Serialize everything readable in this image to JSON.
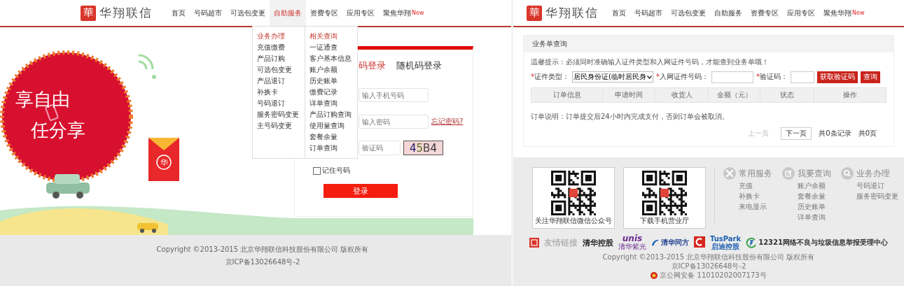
{
  "left_page": {
    "header": {
      "logo_mark": "華",
      "logo_text": "华翔联信",
      "nav": [
        {
          "label": "首页",
          "selected": false
        },
        {
          "label": "号码超市",
          "selected": false
        },
        {
          "label": "可选包变更",
          "selected": false
        },
        {
          "label": "自助服务",
          "selected": true
        },
        {
          "label": "资费专区",
          "selected": false
        },
        {
          "label": "应用专区",
          "selected": false
        },
        {
          "label": "聚焦华翔",
          "badge": "New",
          "selected": false
        }
      ]
    },
    "dropdown": {
      "columns": [
        {
          "title": "业务办理",
          "items": [
            "充值缴费",
            "产品订购",
            "可选包变更",
            "产品退订",
            "补换卡",
            "号码退订",
            "服务密码变更",
            "主号码变更"
          ]
        },
        {
          "title": "相关查询",
          "items": [
            "一证通查",
            "客户基本信息",
            "账户余额",
            "历史账单",
            "缴费记录",
            "详单查询",
            "产品订购查询",
            "使用量查询",
            "套餐余量",
            "订单查询"
          ]
        }
      ]
    },
    "banner": {
      "lines": [
        "享自由",
        "任分享"
      ],
      "envelope_mark": "华"
    },
    "login": {
      "tabs": [
        {
          "label": "码登录",
          "selected": true
        },
        {
          "label": "随机码登录",
          "selected": false
        }
      ],
      "phone": {
        "placeholder": "输入手机号码"
      },
      "password": {
        "placeholder": "输入密码"
      },
      "forgot_link": "忘记密码?",
      "captcha": {
        "placeholder": "验证码",
        "image_text": "45B4"
      },
      "remember": {
        "label": "记住号码",
        "checked": false
      },
      "submit": "登录"
    },
    "footer": {
      "copyright": "Copyright ©2013-2015 北京华翔联信科技股份有限公司 版权所有",
      "icp": "京ICP备13026648号-2"
    }
  },
  "right_page": {
    "header": {
      "logo_mark": "華",
      "logo_text": "华翔联信",
      "nav": [
        {
          "label": "首页",
          "selected": false
        },
        {
          "label": "号码超市",
          "selected": false
        },
        {
          "label": "可选包变更",
          "selected": false
        },
        {
          "label": "自助服务",
          "selected": false
        },
        {
          "label": "资费专区",
          "selected": false
        },
        {
          "label": "应用专区",
          "selected": false
        },
        {
          "label": "聚焦华翔",
          "badge": "New",
          "selected": false
        }
      ]
    },
    "query_card": {
      "title": "业务单查询",
      "hint": "温馨提示：必须同时准确输入证件类型和入网证件号码，才能查到业务单哦！",
      "fields": [
        {
          "kind": "select",
          "mark": "*",
          "label": "证件类型：",
          "value": "居民身份证(临时居民身"
        },
        {
          "kind": "input",
          "mark": "*",
          "label": "入网证件号码："
        },
        {
          "kind": "input",
          "mark": "*",
          "label": "验证码："
        }
      ],
      "buttons": [
        "获取验证码",
        "查询"
      ],
      "table": {
        "columns": [
          "订单信息",
          "申请时间",
          "收货人",
          "金额（元）",
          "状态",
          "操作"
        ]
      },
      "note": "订单说明：订单提交后24小时内完成支付，否则订单会被取消。",
      "pagination": {
        "prev": {
          "label": "上一页",
          "disabled": true
        },
        "next": {
          "label": "下一页",
          "disabled": false
        },
        "total_records": "共0条记录",
        "total_pages": "共0页"
      }
    },
    "footer": {
      "qr_codes": [
        {
          "caption": "关注华翔联信微信公众号"
        },
        {
          "caption": "下载手机营业厅"
        }
      ],
      "link_groups": [
        {
          "kind": "tools",
          "title": "常用服务",
          "links": [
            "充值",
            "补换卡",
            "来电显示"
          ]
        },
        {
          "kind": "edit",
          "title": "我要查询",
          "links": [
            "账户余额",
            "套餐余量",
            "历史账单",
            "详单查询"
          ]
        },
        {
          "kind": "search",
          "title": "业务办理",
          "links": [
            "号码退订",
            "服务密码变更"
          ]
        }
      ],
      "partners": {
        "title": "友情链接",
        "logos": [
          {
            "kind": "qhkg",
            "text": "清华控股"
          },
          {
            "kind": "unis",
            "text": "unis",
            "subtext": "清华紫光"
          },
          {
            "kind": "tongfang",
            "text": "清华同方"
          },
          {
            "kind": "c_logo"
          },
          {
            "kind": "tuspark",
            "text": "TusPark",
            "subtext": "启迪控股"
          },
          {
            "kind": "report",
            "text": "12321网络不良与垃圾信息举报受理中心"
          }
        ]
      },
      "copyright": "Copyright ©2013-2015 北京华翔联信科技股份有限公司 版权所有",
      "icp": "京ICP备13026648号-2",
      "police": "京公网安备 11010202007173号"
    }
  }
}
